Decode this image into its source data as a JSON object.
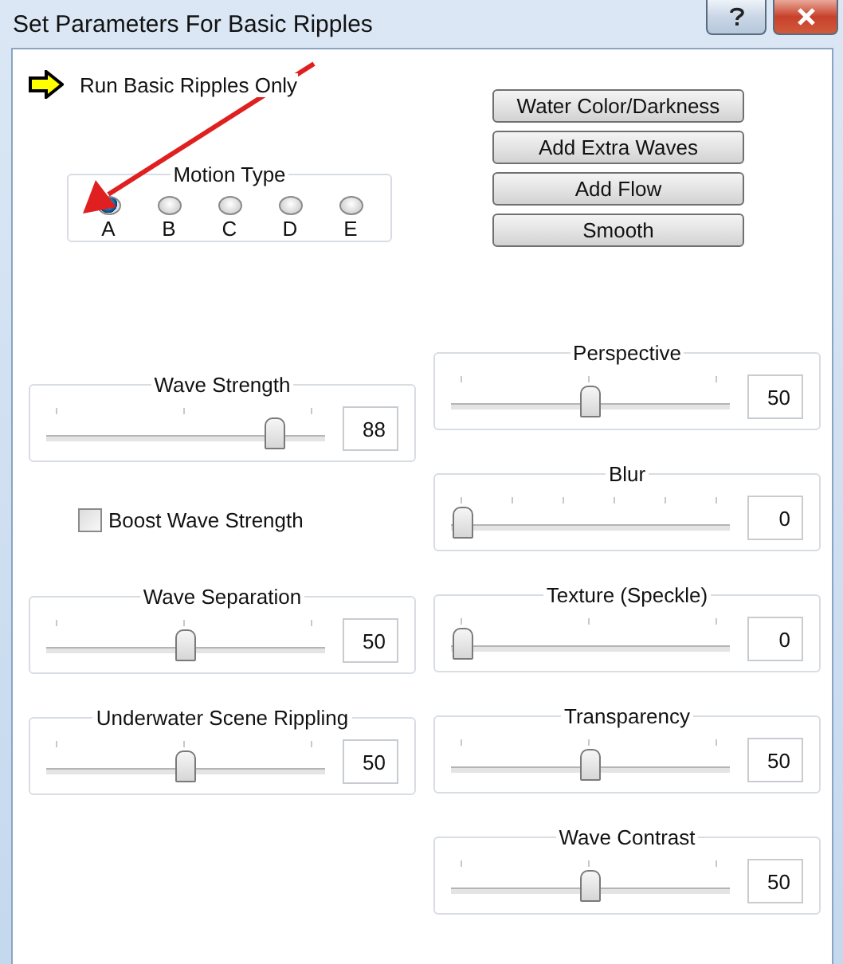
{
  "window": {
    "title": "Set Parameters For Basic Ripples"
  },
  "run_label": "Run Basic Ripples Only",
  "motion_type": {
    "label": "Motion Type",
    "options": [
      {
        "label": "A",
        "selected": true
      },
      {
        "label": "B",
        "selected": false
      },
      {
        "label": "C",
        "selected": false
      },
      {
        "label": "D",
        "selected": false
      },
      {
        "label": "E",
        "selected": false
      }
    ]
  },
  "buttons": [
    "Water Color/Darkness",
    "Add Extra Waves",
    "Add Flow",
    "Smooth"
  ],
  "left_sliders": [
    {
      "label": "Wave Strength",
      "kind": "coarse",
      "level": 0.85,
      "value": "88"
    },
    {
      "kind": "checkbox",
      "label": "Boost Wave Strength",
      "checked": false
    },
    {
      "label": "Wave Separation",
      "kind": "coarse",
      "level": 0.5,
      "value": "50"
    },
    {
      "label": "Underwater Scene Rippling",
      "kind": "coarse",
      "level": 0.5,
      "value": "50"
    }
  ],
  "right_sliders": [
    {
      "label": "Perspective",
      "kind": "coarse",
      "level": 0.5,
      "value": "50"
    },
    {
      "label": "Blur",
      "kind": "fine",
      "level": 0,
      "value": "0"
    },
    {
      "label": "Texture (Speckle)",
      "kind": "coarse",
      "level": 0,
      "value": "0"
    },
    {
      "label": "Transparency",
      "kind": "coarse",
      "level": 0.5,
      "value": "50"
    },
    {
      "label": "Wave Contrast",
      "kind": "coarse",
      "level": 0.5,
      "value": "50"
    }
  ]
}
